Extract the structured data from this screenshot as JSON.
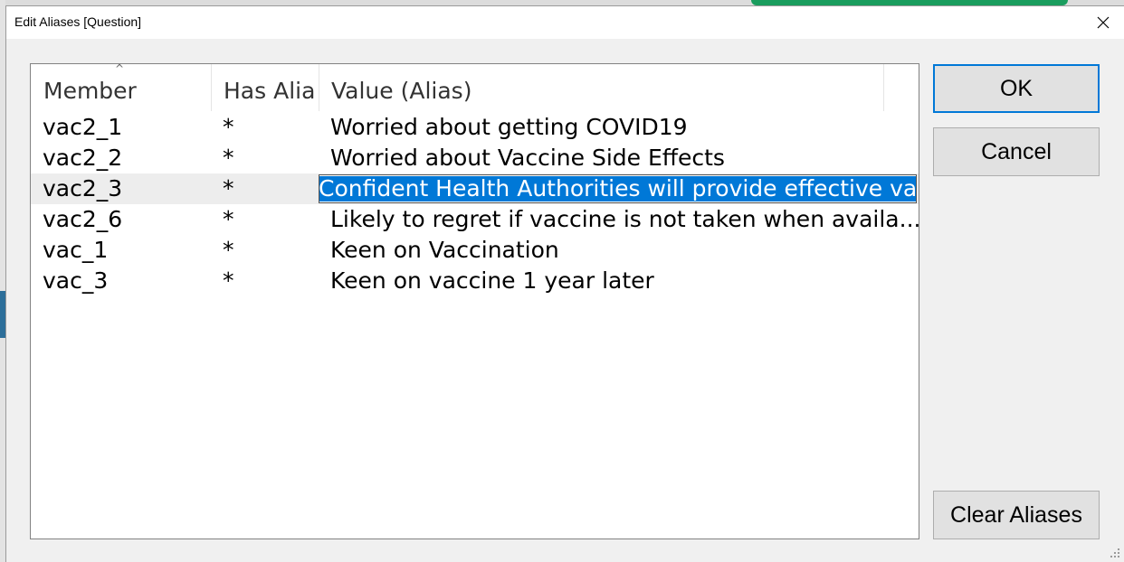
{
  "window": {
    "title": "Edit Aliases [Question]"
  },
  "table": {
    "columns": [
      "Member",
      "Has Alia",
      "Value (Alias)"
    ],
    "sorted_column": "Member",
    "rows": [
      {
        "member": "vac2_1",
        "has_alias": "*",
        "value": "Worried about getting COVID19"
      },
      {
        "member": "vac2_2",
        "has_alias": "*",
        "value": "Worried about Vaccine Side Effects"
      },
      {
        "member": "vac2_3",
        "has_alias": "*",
        "value": "Confident Health Authorities will provide effective vaccine"
      },
      {
        "member": "vac2_6",
        "has_alias": "*",
        "value": "Likely to regret if vaccine is not taken when availa..."
      },
      {
        "member": "vac_1",
        "has_alias": "*",
        "value": "Keen on Vaccination"
      },
      {
        "member": "vac_3",
        "has_alias": "*",
        "value": "Keen on vaccine 1 year later"
      }
    ],
    "editing_value": "Confident Health Authorities will provide effective vaccine"
  },
  "buttons": {
    "ok": "OK",
    "cancel": "Cancel",
    "clear": "Clear Aliases"
  },
  "colors": {
    "selection": "#0078d7",
    "accent_green": "#1a9d5e"
  },
  "icons": {
    "close": "close-icon",
    "sort": "sort-ascending-icon",
    "resize": "resize-grip-icon"
  }
}
